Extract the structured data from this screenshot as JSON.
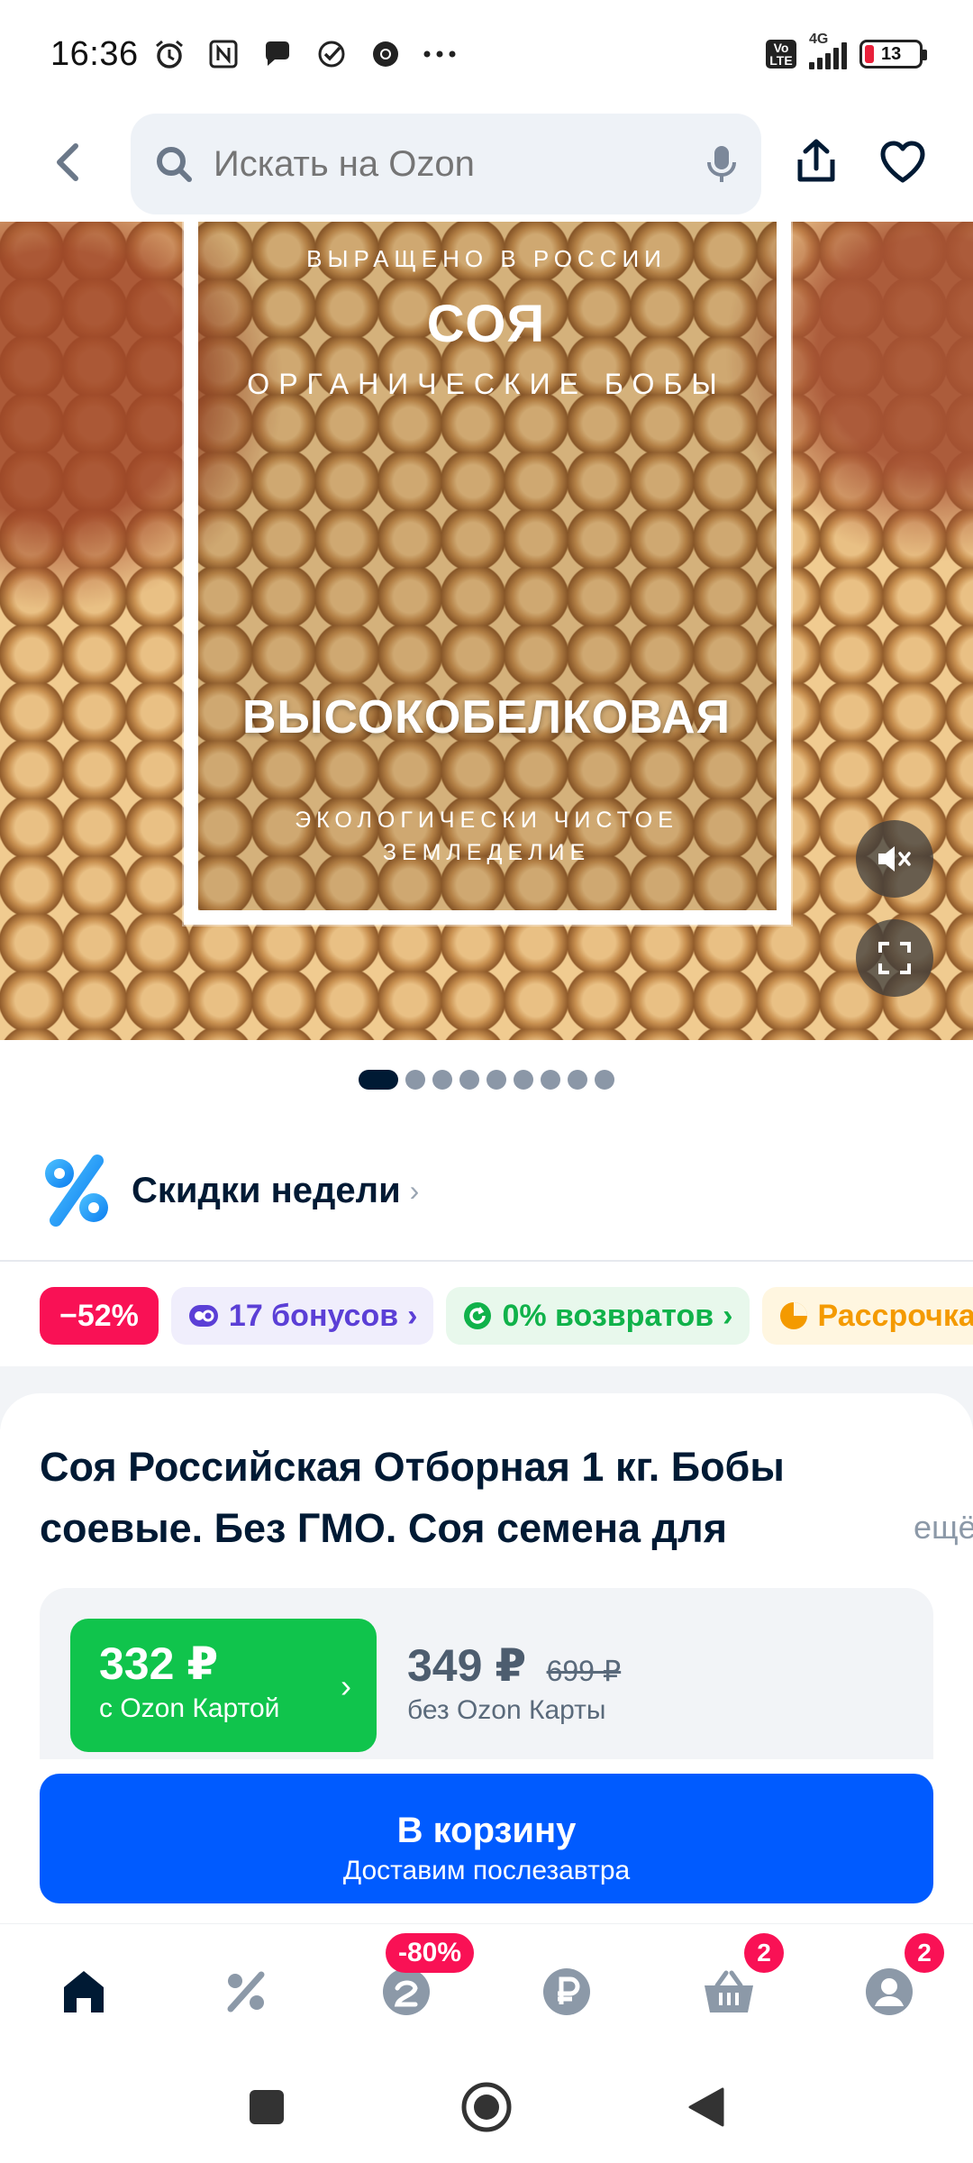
{
  "status_bar": {
    "time": "16:36",
    "network": "4G",
    "volte": "Vo LTE",
    "battery": "13"
  },
  "header": {
    "search_placeholder": "Искать на Ozon"
  },
  "hero": {
    "line1": "ВЫРАЩЕНО В РОССИИ",
    "line2": "СОЯ",
    "line3": "ОРГАНИЧЕСКИЕ БОБЫ",
    "line4": "ВЫСОКОБЕЛКОВАЯ",
    "line5": "ЭКОЛОГИЧЕСКИ ЧИСТОЕ ЗЕМЛЕДЕЛИЕ",
    "gallery_count": 10,
    "active_index": 0
  },
  "deals": {
    "label": "Скидки недели",
    "chevron": "›"
  },
  "chips": {
    "discount": "−52%",
    "bonus": "17 бонусов",
    "returns": "0% возвратов",
    "installment": "Рассрочка",
    "chevron": "›"
  },
  "product": {
    "title": "Соя Российская Отборная 1 кг. Бобы соевые. Без ГМО. Соя семена для",
    "more": "ещё",
    "price_card": "332 ₽",
    "price_card_label": "с Ozon Картой",
    "price": "349 ₽",
    "price_old": "699 ₽",
    "price_label": "без Ozon Карты",
    "chevron": "›"
  },
  "cart_button": {
    "label": "В корзину",
    "sublabel": "Доставим послезавтра"
  },
  "bottom_nav": {
    "promo_badge": "-80%",
    "cart_badge": "2",
    "profile_badge": "2"
  },
  "colors": {
    "ozon_blue": "#005bff",
    "green": "#10c44c",
    "pink": "#f91155"
  }
}
